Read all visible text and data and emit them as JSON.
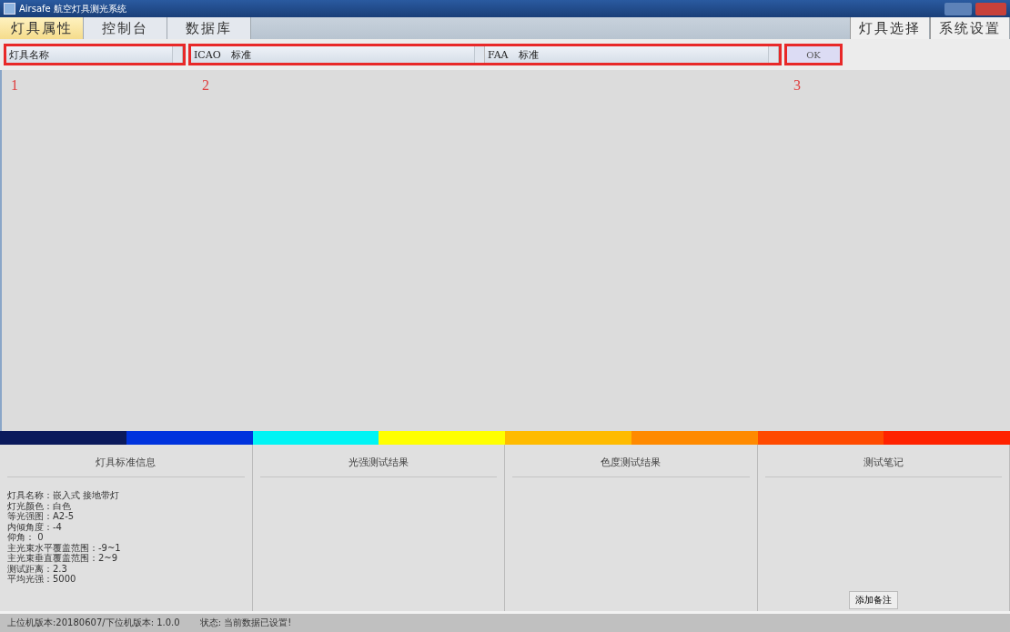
{
  "window": {
    "title": "Airsafe 航空灯具测光系统"
  },
  "tabs": [
    {
      "label": "灯具属性",
      "selected": true
    },
    {
      "label": "控制台",
      "selected": false
    },
    {
      "label": "数据库",
      "selected": false
    }
  ],
  "right_tabs": [
    {
      "label": "灯具选择"
    },
    {
      "label": "系统设置"
    }
  ],
  "toolbar": {
    "fixture_select": {
      "value": "灯具名称"
    },
    "icao_select": {
      "value": "ICAO　标准"
    },
    "faa_select": {
      "value": "FAA　标准"
    },
    "ok_button": "OK"
  },
  "annotations": [
    {
      "number": "1"
    },
    {
      "number": "2"
    },
    {
      "number": "3"
    }
  ],
  "color_scale": [
    {
      "color": "#0b1a5c"
    },
    {
      "color": "#0033dd"
    },
    {
      "color": "#00f4f4"
    },
    {
      "color": "#ffff00"
    },
    {
      "color": "#ffbb00"
    },
    {
      "color": "#ff8a00"
    },
    {
      "color": "#ff4a00"
    },
    {
      "color": "#ff2200"
    }
  ],
  "panels": [
    {
      "title": "灯具标准信息",
      "lines": [
        "灯具名称：嵌入式 接地带灯",
        "灯光颜色：白色",
        "等光强图：A2-5",
        "内倾角度：-4",
        "仰角： 0",
        "主光束水平覆盖范围：-9~1",
        "主光束垂直覆盖范围：2~9",
        "测试距离：2.3",
        "平均光强：5000"
      ]
    },
    {
      "title": "光强测试结果"
    },
    {
      "title": "色度测试结果"
    },
    {
      "title": "测试笔记",
      "button": "添加备注"
    }
  ],
  "status_bar": {
    "version": "上位机版本:20180607/下位机版本: 1.0.0",
    "state": "状态: 当前数据已设置!"
  }
}
